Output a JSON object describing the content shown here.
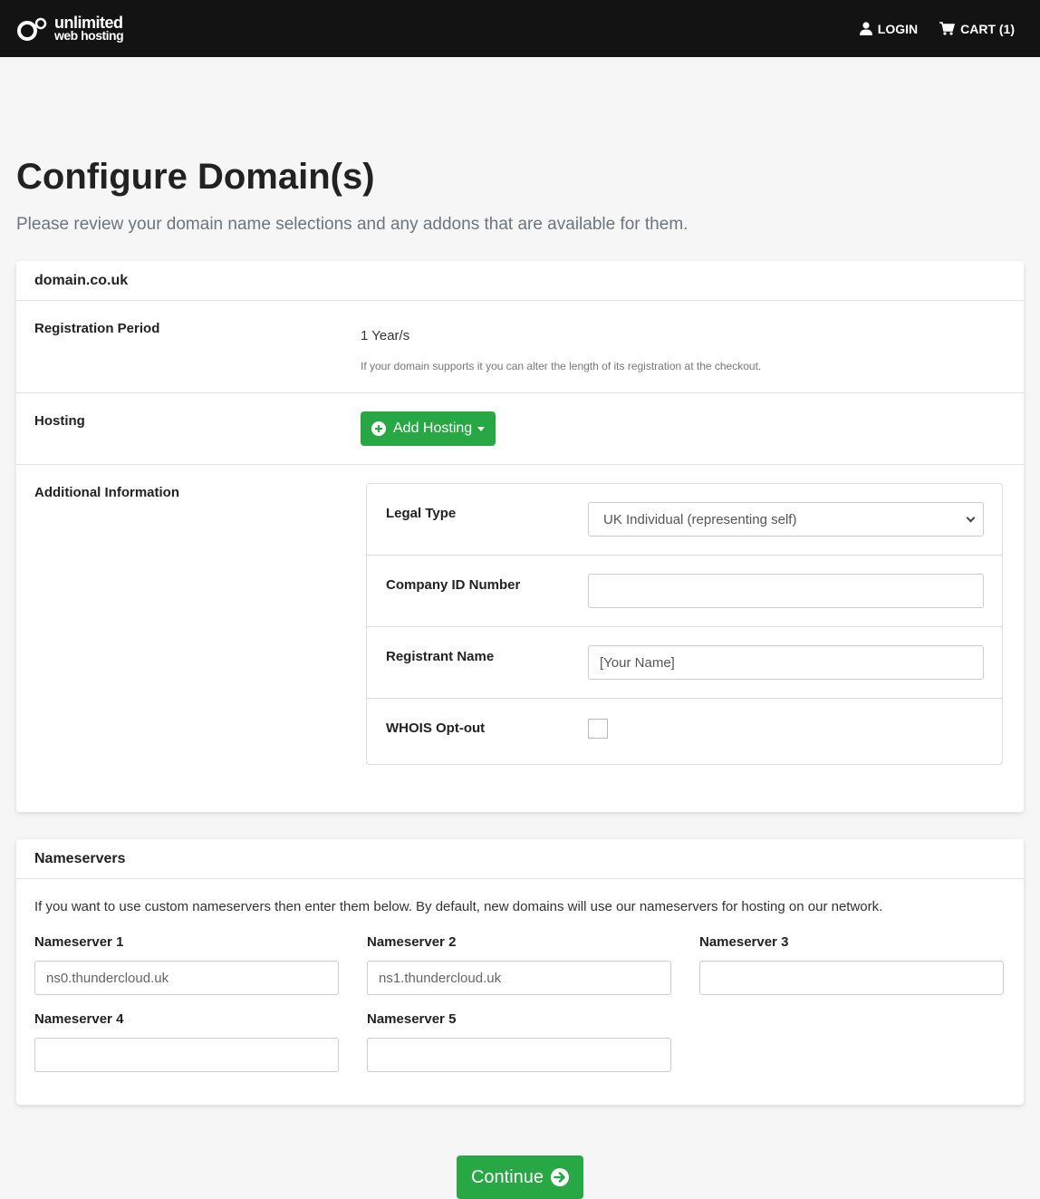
{
  "brand": {
    "line1": "unlimited",
    "line2": "web hosting",
    "mark": "·"
  },
  "nav": {
    "login": "LOGIN",
    "cart": "CART (1)"
  },
  "page": {
    "title": "Configure Domain(s)",
    "subtitle": "Please review your domain name selections and any addons that are available for them."
  },
  "domain_card": {
    "domain": "domain.co.uk",
    "registration_label": "Registration Period",
    "registration_value": "1 Year/s",
    "registration_help": "If your domain supports it you can alter the length of its registration at the checkout.",
    "hosting_label": "Hosting",
    "add_hosting": "Add Hosting",
    "additional_label": "Additional Information",
    "fields": {
      "legal_type_label": "Legal Type",
      "legal_type_value": "UK Individual (representing self)",
      "company_id_label": "Company ID Number",
      "company_id_value": "",
      "registrant_label": "Registrant Name",
      "registrant_value": "[Your Name]",
      "whois_label": "WHOIS Opt-out",
      "whois_checked": false
    }
  },
  "nameservers": {
    "title": "Nameservers",
    "intro": "If you want to use custom nameservers then enter them below. By default, new domains will use our nameservers for hosting on our network.",
    "items": [
      {
        "label": "Nameserver 1",
        "value": "ns0.thundercloud.uk"
      },
      {
        "label": "Nameserver 2",
        "value": "ns1.thundercloud.uk"
      },
      {
        "label": "Nameserver 3",
        "value": ""
      },
      {
        "label": "Nameserver 4",
        "value": ""
      },
      {
        "label": "Nameserver 5",
        "value": ""
      }
    ]
  },
  "continue": "Continue",
  "colors": {
    "accent": "#28a745",
    "topbar": "#131313",
    "background": "#f6f6f6"
  }
}
